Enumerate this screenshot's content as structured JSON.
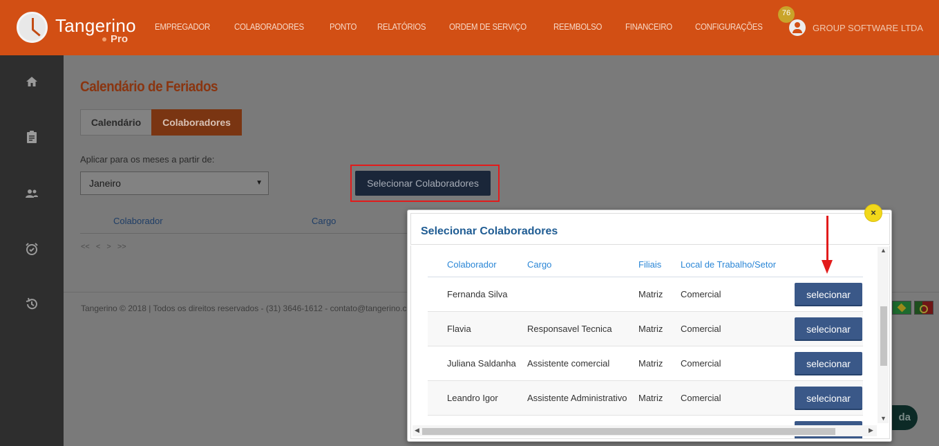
{
  "header": {
    "logo_text": "Tangerino",
    "logo_sub": "Pro",
    "nav": [
      "EMPREGADOR",
      "COLABORADORES",
      "PONTO",
      "RELATÓRIOS",
      "ORDEM DE SERVIÇO",
      "REEMBOLSO",
      "FINANCEIRO",
      "CONFIGURAÇÕES"
    ],
    "notification_count": "76",
    "company": "GROUP SOFTWARE LTDA"
  },
  "sidebar": {
    "icons": [
      "home-icon",
      "clipboard-icon",
      "users-icon",
      "alarm-icon",
      "history-icon"
    ]
  },
  "page": {
    "title": "Calendário de Feriados",
    "tabs": [
      "Calendário",
      "Colaboradores"
    ],
    "apply_label": "Aplicar para os meses a partir de:",
    "month_selected": "Janeiro",
    "select_button": "Selecionar Colaboradores",
    "columns": [
      "Colaborador",
      "Cargo"
    ],
    "pager": "<< < > >>",
    "footer": "Tangerino © 2018 | Todos os direitos reservados - (31) 3646-1612 - contato@tangerino.com.br",
    "help_label": "da"
  },
  "modal": {
    "title": "Selecionar Colaboradores",
    "close": "×",
    "columns": [
      "Colaborador",
      "Cargo",
      "Filiais",
      "Local de Trabalho/Setor"
    ],
    "button_label": "selecionar",
    "rows": [
      {
        "name": "Fernanda Silva",
        "cargo": "",
        "filial": "Matriz",
        "local": "Comercial"
      },
      {
        "name": "Flavia",
        "cargo": "Responsavel Tecnica",
        "filial": "Matriz",
        "local": "Comercial"
      },
      {
        "name": "Juliana Saldanha",
        "cargo": "Assistente comercial",
        "filial": "Matriz",
        "local": "Comercial"
      },
      {
        "name": "Leandro Igor",
        "cargo": "Assistente Administrativo",
        "filial": "Matriz",
        "local": "Comercial"
      },
      {
        "name": "",
        "cargo": "",
        "filial": "",
        "local": ""
      }
    ]
  },
  "colors": {
    "brand_orange": "#d24f14",
    "sidebar": "#2e2e2e",
    "modal_title": "#1f5c93",
    "button_blue": "#3a5888",
    "annotation_red": "#e21b1b"
  }
}
